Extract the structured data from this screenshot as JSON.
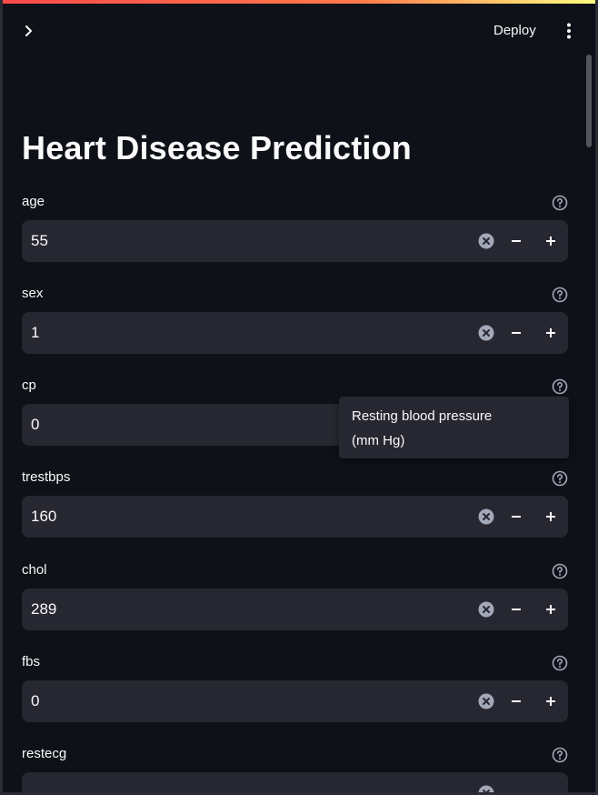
{
  "header": {
    "deploy_label": "Deploy"
  },
  "page": {
    "title": "Heart Disease Prediction"
  },
  "fields": [
    {
      "label": "age",
      "value": "55"
    },
    {
      "label": "sex",
      "value": "1"
    },
    {
      "label": "cp",
      "value": "0"
    },
    {
      "label": "trestbps",
      "value": "160"
    },
    {
      "label": "chol",
      "value": "289"
    },
    {
      "label": "fbs",
      "value": "0"
    },
    {
      "label": "restecg",
      "value": ""
    }
  ],
  "tooltip": {
    "line1": "Resting blood pressure",
    "line2": "(mm Hg)"
  },
  "icons": {
    "sidebar_toggle": "chevron-right-icon",
    "menu": "vertical-dots-icon",
    "help": "question-circle-icon",
    "clear": "clear-x-circle-icon",
    "minus": "minus-icon",
    "plus": "plus-icon"
  },
  "colors": {
    "background": "#0e1117",
    "input": "#262730",
    "text": "#fafafa",
    "accent": "#ff4b4b"
  }
}
